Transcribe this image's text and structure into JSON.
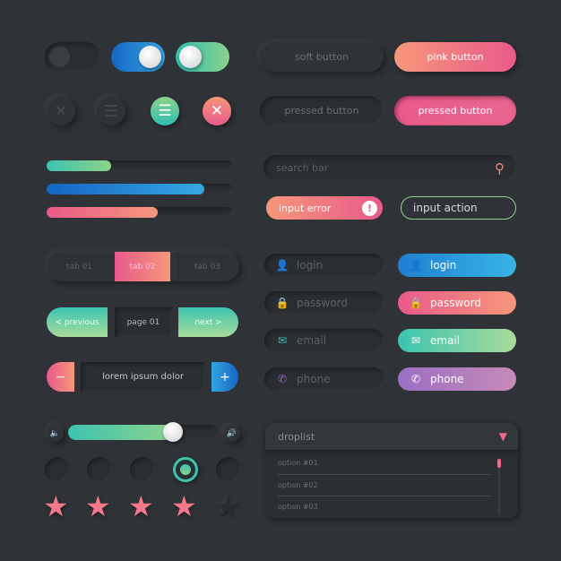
{
  "toggles": [
    {
      "state": "off"
    },
    {
      "state": "on",
      "color": "#1e7fd0"
    },
    {
      "state": "on",
      "color": "#3cc3b0"
    }
  ],
  "progress": [
    {
      "value": 35,
      "color": "#3cc3b0"
    },
    {
      "value": 85,
      "color": "#2a8fd8"
    },
    {
      "value": 60,
      "color": "#e95a8a"
    }
  ],
  "tabs": [
    {
      "label": "tab 01"
    },
    {
      "label": "tab 02",
      "active": true
    },
    {
      "label": "tab 03"
    }
  ],
  "pagination": {
    "prev": "< previous",
    "page": "page 01",
    "next": "next >"
  },
  "stepper": {
    "minus": "−",
    "value": "lorem ipsum dolor",
    "plus": "+"
  },
  "slider": {
    "value": 70
  },
  "radios": {
    "selected_index": 3,
    "count": 5
  },
  "rating": {
    "value": 4,
    "max": 5
  },
  "buttons": {
    "soft": "soft button",
    "pink": "pink button",
    "pressed": "pressed button",
    "pressed_pink": "pressed button"
  },
  "search": {
    "placeholder": "search bar"
  },
  "inputs": {
    "error": "input error",
    "action": "input action"
  },
  "fields": {
    "login": "login",
    "password": "password",
    "email": "email",
    "phone": "phone"
  },
  "droplist": {
    "label": "droplist",
    "options": [
      "option #01",
      "option #02",
      "option #03"
    ]
  },
  "colors": {
    "background": "#2f3236",
    "pink": "#e95a8a",
    "peach": "#f5977a",
    "teal": "#3cc3b0",
    "blue": "#1e7fd0",
    "purple": "#9b6fc4"
  }
}
